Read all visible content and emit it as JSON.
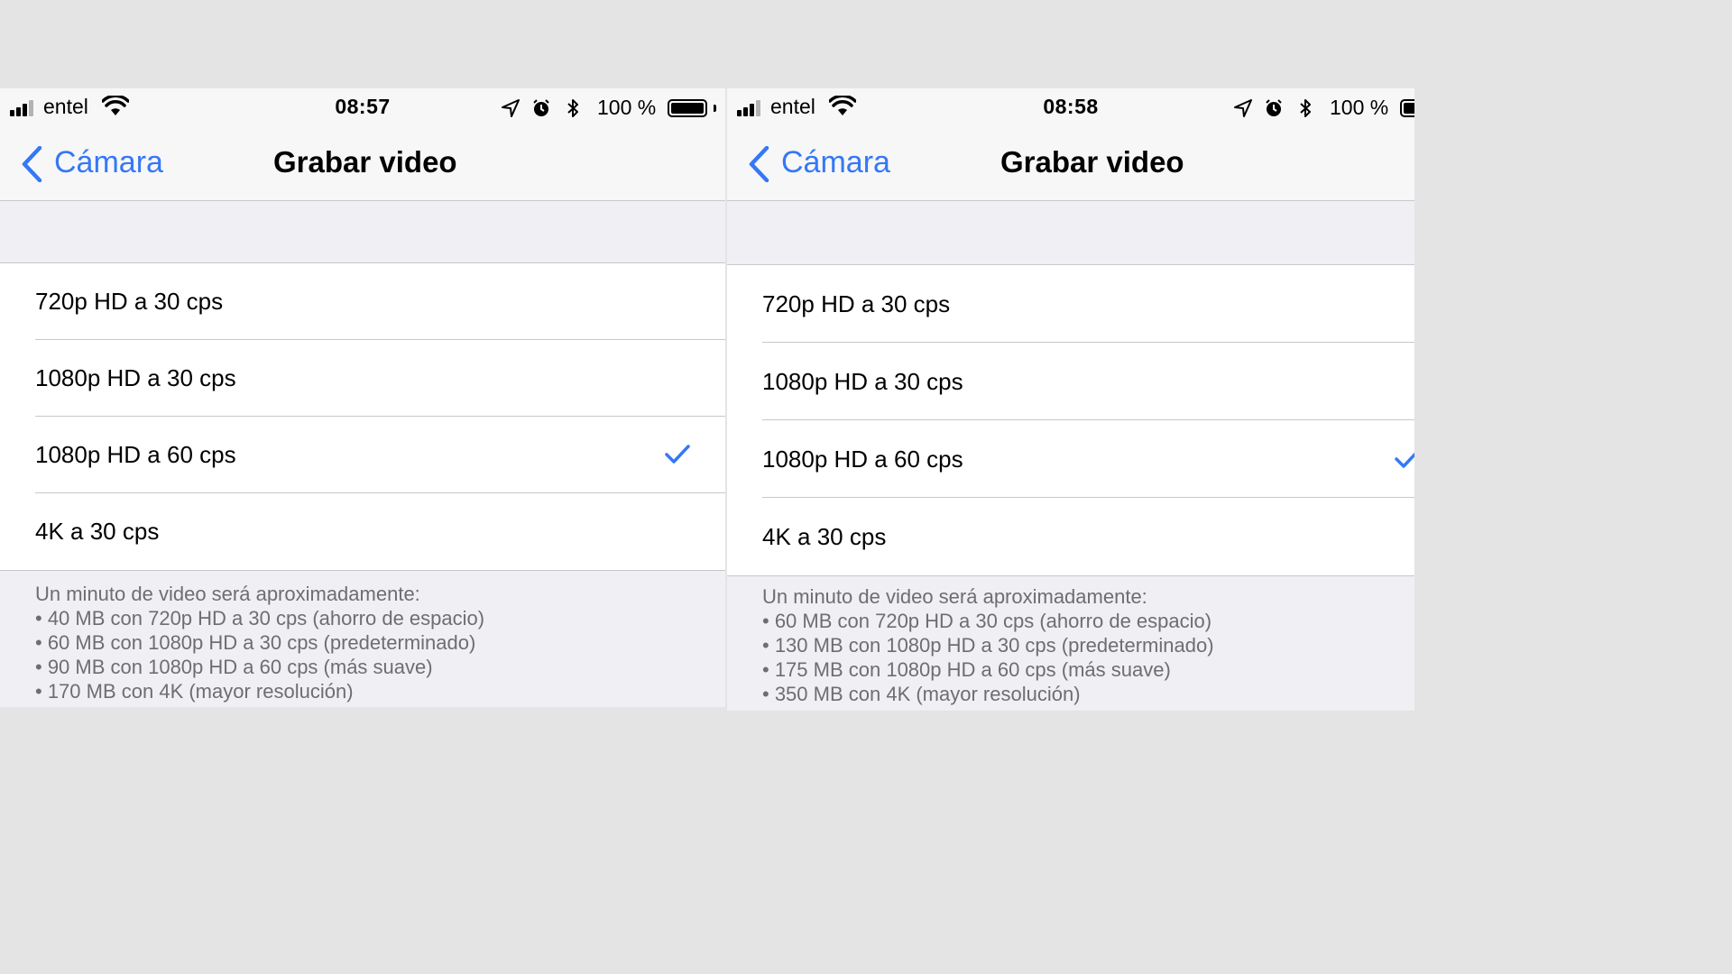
{
  "screens": [
    {
      "status": {
        "carrier": "entel",
        "time": "08:57",
        "battery": "100 %"
      },
      "nav": {
        "back_label": "Cámara",
        "title": "Grabar video"
      },
      "options": [
        {
          "label": "720p HD a 30 cps",
          "selected": false
        },
        {
          "label": "1080p HD a 30 cps",
          "selected": false
        },
        {
          "label": "1080p HD a 60 cps",
          "selected": true
        },
        {
          "label": "4K a 30 cps",
          "selected": false
        }
      ],
      "footer": {
        "intro": "Un minuto de video será aproximadamente:",
        "items": [
          "• 40 MB con 720p HD a 30 cps (ahorro de espacio)",
          "• 60 MB con 1080p HD a 30 cps (predeterminado)",
          "• 90 MB con 1080p HD a 60 cps (más suave)",
          "• 170 MB con 4K (mayor resolución)"
        ]
      }
    },
    {
      "status": {
        "carrier": "entel",
        "time": "08:58",
        "battery": "100 %"
      },
      "nav": {
        "back_label": "Cámara",
        "title": "Grabar video"
      },
      "options": [
        {
          "label": "720p HD a 30 cps",
          "selected": false
        },
        {
          "label": "1080p HD a 30 cps",
          "selected": false
        },
        {
          "label": "1080p HD a 60 cps",
          "selected": true
        },
        {
          "label": "4K a 30 cps",
          "selected": false
        }
      ],
      "footer": {
        "intro": "Un minuto de video será aproximadamente:",
        "items": [
          "• 60 MB con 720p HD a 30 cps (ahorro de espacio)",
          "• 130 MB con 1080p HD a 30 cps (predeterminado)",
          "• 175 MB con 1080p HD a 60 cps (más suave)",
          "• 350 MB con 4K (mayor resolución)"
        ]
      }
    }
  ],
  "colors": {
    "accent": "#3478f6",
    "background": "#efeff4",
    "footer_text": "#6d6d72",
    "separator": "#c8c7cc"
  },
  "icons": [
    "cellular-signal-icon",
    "wifi-icon",
    "location-arrow-icon",
    "alarm-icon",
    "bluetooth-icon",
    "battery-icon",
    "chevron-left-icon",
    "checkmark-icon"
  ]
}
